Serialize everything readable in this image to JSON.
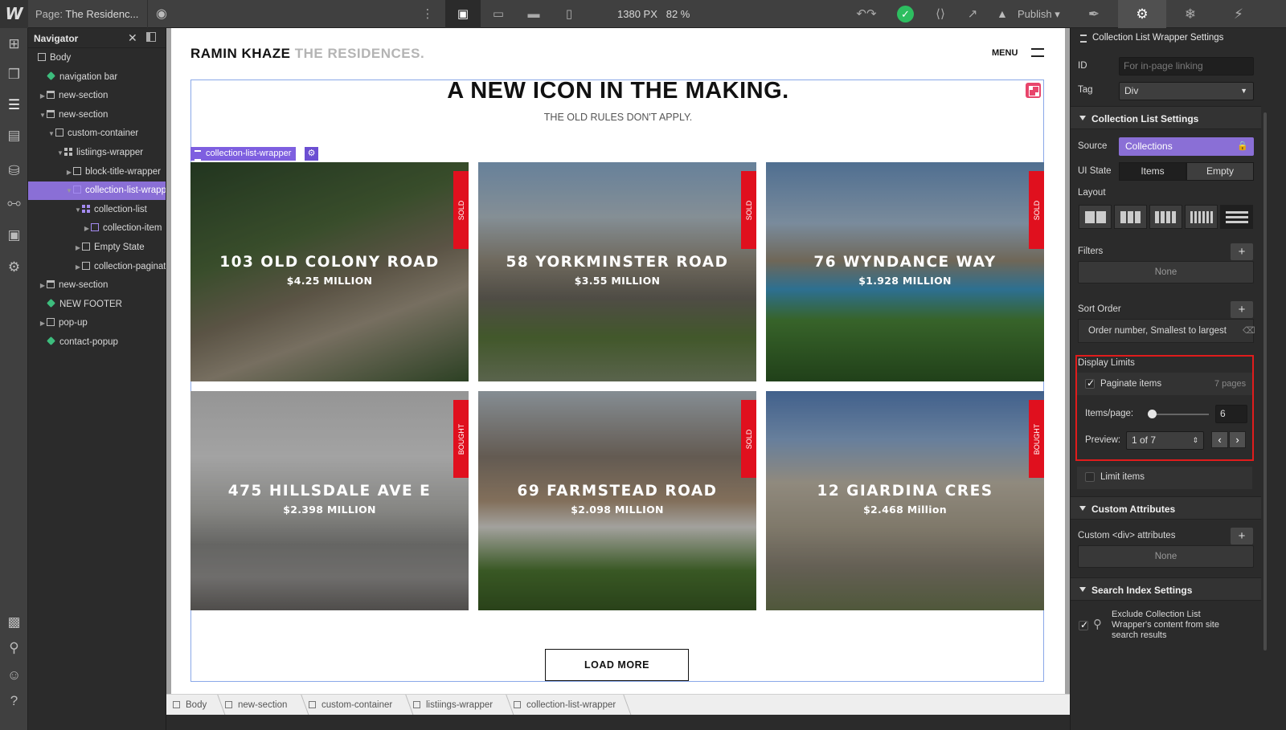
{
  "topbar": {
    "page_prefix": "Page:",
    "page_name": "The Residenc...",
    "canvas_size": "1380 PX",
    "zoom": "82 %",
    "publish_label": "Publish"
  },
  "navigator": {
    "title": "Navigator",
    "tree": [
      {
        "label": "Body",
        "indent": 0,
        "icon": "box"
      },
      {
        "label": "navigation bar",
        "indent": 1,
        "icon": "symbol"
      },
      {
        "label": "new-section",
        "indent": 1,
        "icon": "section",
        "arrow": "right"
      },
      {
        "label": "new-section",
        "indent": 1,
        "icon": "section",
        "arrow": "down"
      },
      {
        "label": "custom-container",
        "indent": 2,
        "icon": "box",
        "arrow": "down"
      },
      {
        "label": "listiings-wrapper",
        "indent": 3,
        "icon": "grid",
        "arrow": "down"
      },
      {
        "label": "block-title-wrapper",
        "indent": 4,
        "icon": "box",
        "arrow": "right"
      },
      {
        "label": "collection-list-wrapper",
        "indent": 4,
        "icon": "collection",
        "arrow": "down",
        "selected": true
      },
      {
        "label": "collection-list",
        "indent": 5,
        "icon": "pgrid",
        "arrow": "down"
      },
      {
        "label": "collection-item",
        "indent": 6,
        "icon": "purple",
        "arrow": "right"
      },
      {
        "label": "Empty State",
        "indent": 5,
        "icon": "empty",
        "arrow": "right"
      },
      {
        "label": "collection-pagination",
        "indent": 5,
        "icon": "box",
        "arrow": "right"
      },
      {
        "label": "new-section",
        "indent": 1,
        "icon": "section",
        "arrow": "right"
      },
      {
        "label": "NEW FOOTER",
        "indent": 1,
        "icon": "symbol"
      },
      {
        "label": "pop-up",
        "indent": 1,
        "icon": "box",
        "arrow": "right"
      },
      {
        "label": "contact-popup",
        "indent": 1,
        "icon": "symbol"
      }
    ]
  },
  "site": {
    "brand_main": "RAMIN KHAZE",
    "brand_sub": "THE RESIDENCES.",
    "menu_label": "MENU",
    "hero_title": "A NEW ICON IN THE MAKING.",
    "hero_subtitle": "THE OLD RULES DON'T APPLY.",
    "selected_label": "collection-list-wrapper",
    "load_more": "LOAD MORE",
    "listings": [
      {
        "name": "103 OLD COLONY ROAD",
        "price": "$4.25 MILLION",
        "tag": "SOLD",
        "scene": "path"
      },
      {
        "name": "58 YORKMINSTER ROAD",
        "price": "$3.55 MILLION",
        "tag": "SOLD",
        "scene": "house"
      },
      {
        "name": "76 WYNDANCE WAY",
        "price": "$1.928 MILLION",
        "tag": "SOLD",
        "scene": "pool"
      },
      {
        "name": "475 HILLSDALE AVE E",
        "price": "$2.398 MILLION",
        "tag": "BOUGHT",
        "scene": "interior"
      },
      {
        "name": "69 FARMSTEAD ROAD",
        "price": "$2.098 MILLION",
        "tag": "SOLD",
        "scene": "house2"
      },
      {
        "name": "12 GIARDINA CRES",
        "price": "$2.468 Million",
        "tag": "BOUGHT",
        "scene": "house3"
      }
    ]
  },
  "breadcrumb": [
    "Body",
    "new-section",
    "custom-container",
    "listiings-wrapper",
    "collection-list-wrapper"
  ],
  "settings": {
    "title": "Collection List Wrapper Settings",
    "id_label": "ID",
    "id_placeholder": "For in-page linking",
    "tag_label": "Tag",
    "tag_value": "Div",
    "collection_list_settings": "Collection List Settings",
    "source_label": "Source",
    "source_value": "Collections",
    "ui_state_label": "UI State",
    "ui_state_items": "Items",
    "ui_state_empty": "Empty",
    "layout_label": "Layout",
    "filters_label": "Filters",
    "filters_value": "None",
    "sort_label": "Sort Order",
    "sort_value": "Order number, Smallest to largest",
    "display_limits_label": "Display Limits",
    "paginate_label": "Paginate items",
    "paginate_checked": true,
    "pages_count": "7 pages",
    "items_per_page_label": "Items/page:",
    "items_per_page": "6",
    "items_per_page_fraction": 0.06,
    "preview_label": "Preview:",
    "preview_value": "1 of 7",
    "limit_items_label": "Limit items",
    "limit_items_checked": false,
    "custom_attributes": "Custom Attributes",
    "custom_div_label": "Custom <div> attributes",
    "custom_div_value": "None",
    "search_index": "Search Index Settings",
    "exclude_line1": "Exclude Collection List",
    "exclude_line2": "Wrapper's content from site",
    "exclude_line3": "search results",
    "exclude_checked": true
  },
  "colors": {
    "selection": "#8a6fd6",
    "sold_tag": "#e0101e",
    "highlight_box": "#e01c1c",
    "publish_check": "#2dbe60"
  }
}
